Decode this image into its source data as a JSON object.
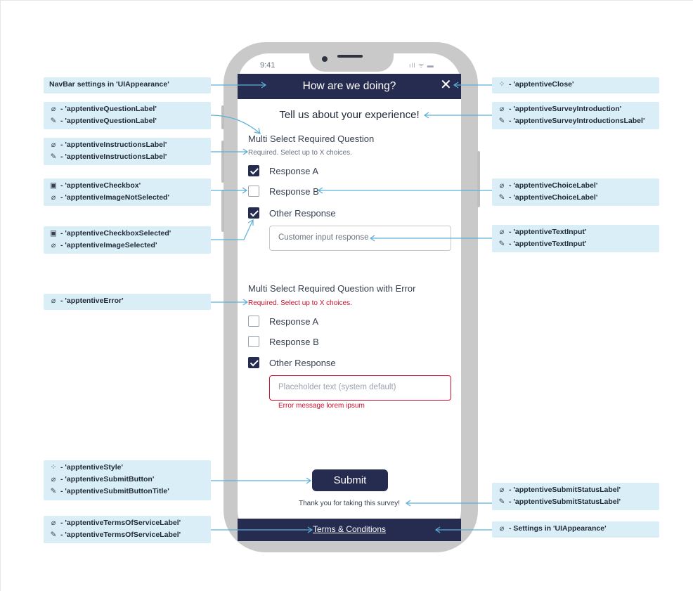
{
  "phone": {
    "status_time": "9:41",
    "status_icons": "ıll ᯤ ▬",
    "navbar_title": "How are we doing?",
    "close_glyph": "✕"
  },
  "survey": {
    "introduction": "Tell us about your experience!",
    "question1": {
      "label": "Multi Select Required Question",
      "instructions": "Required. Select up to X choices.",
      "choices": [
        {
          "label": "Response A",
          "checked": true
        },
        {
          "label": "Response B",
          "checked": false
        },
        {
          "label": "Other Response",
          "checked": true
        }
      ],
      "text_input_value": "Customer input response"
    },
    "question2": {
      "label": "Multi Select Required Question with Error",
      "instructions": "Required. Select up to X choices.",
      "choices": [
        {
          "label": "Response A",
          "checked": false
        },
        {
          "label": "Response B",
          "checked": false
        },
        {
          "label": "Other Response",
          "checked": true
        }
      ],
      "text_input_placeholder": "Placeholder text (system default)",
      "error_message": "Error message lorem ipsum"
    },
    "submit_label": "Submit",
    "submit_status": "Thank you for taking this survey!",
    "terms_label": "Terms & Conditions"
  },
  "annotations_left": [
    {
      "lines": [
        {
          "icon": "",
          "text": "NavBar settings in 'UIAppearance'"
        }
      ]
    },
    {
      "lines": [
        {
          "icon": "⌀",
          "text": "- 'apptentiveQuestionLabel'"
        },
        {
          "icon": "✎",
          "text": "- 'apptentiveQuestionLabel'"
        }
      ]
    },
    {
      "lines": [
        {
          "icon": "⌀",
          "text": "- 'apptentiveInstructionsLabel'"
        },
        {
          "icon": "✎",
          "text": "- 'apptentiveInstructionsLabel'"
        }
      ]
    },
    {
      "lines": [
        {
          "icon": "▣",
          "text": "- 'apptentiveCheckbox'"
        },
        {
          "icon": "⌀",
          "text": "- 'apptentiveImageNotSelected'"
        }
      ]
    },
    {
      "lines": [
        {
          "icon": "▣",
          "text": "- 'apptentiveCheckboxSelected'"
        },
        {
          "icon": "⌀",
          "text": "- 'apptentiveImageSelected'"
        }
      ]
    },
    {
      "lines": [
        {
          "icon": "⌀",
          "text": "- 'apptentiveError'"
        }
      ]
    },
    {
      "lines": [
        {
          "icon": "⁘",
          "text": "- 'apptentiveStyle'"
        },
        {
          "icon": "⌀",
          "text": "- 'apptentiveSubmitButton'"
        },
        {
          "icon": "✎",
          "text": "- 'apptentiveSubmitButtonTitle'"
        }
      ]
    },
    {
      "lines": [
        {
          "icon": "⌀",
          "text": "- 'apptentiveTermsOfServiceLabel'"
        },
        {
          "icon": "✎",
          "text": "- 'apptentiveTermsOfServiceLabel'"
        }
      ]
    }
  ],
  "annotations_right": [
    {
      "lines": [
        {
          "icon": "⁘",
          "text": "- 'apptentiveClose'"
        }
      ]
    },
    {
      "lines": [
        {
          "icon": "⌀",
          "text": "- 'apptentiveSurveyIntroduction'"
        },
        {
          "icon": "✎",
          "text": "- 'apptentiveSurveyIntroductionsLabel'"
        }
      ]
    },
    {
      "lines": [
        {
          "icon": "⌀",
          "text": "- 'apptentiveChoiceLabel'"
        },
        {
          "icon": "✎",
          "text": "- 'apptentiveChoiceLabel'"
        }
      ]
    },
    {
      "lines": [
        {
          "icon": "⌀",
          "text": "- 'apptentiveTextInput'"
        },
        {
          "icon": "✎",
          "text": "- 'apptentiveTextInput'"
        }
      ]
    },
    {
      "lines": [
        {
          "icon": "⌀",
          "text": "- 'apptentiveSubmitStatusLabel'"
        },
        {
          "icon": "✎",
          "text": "- 'apptentiveSubmitStatusLabel'"
        }
      ]
    },
    {
      "lines": [
        {
          "icon": "⌀",
          "text": "- Settings in 'UIAppearance'"
        }
      ]
    }
  ],
  "colors": {
    "navy": "#262b50",
    "annotation_bg": "#d9eef7",
    "leader_line": "#5ab0d6",
    "error_red": "#c8102e",
    "phone_frame": "#c9c9c9"
  }
}
